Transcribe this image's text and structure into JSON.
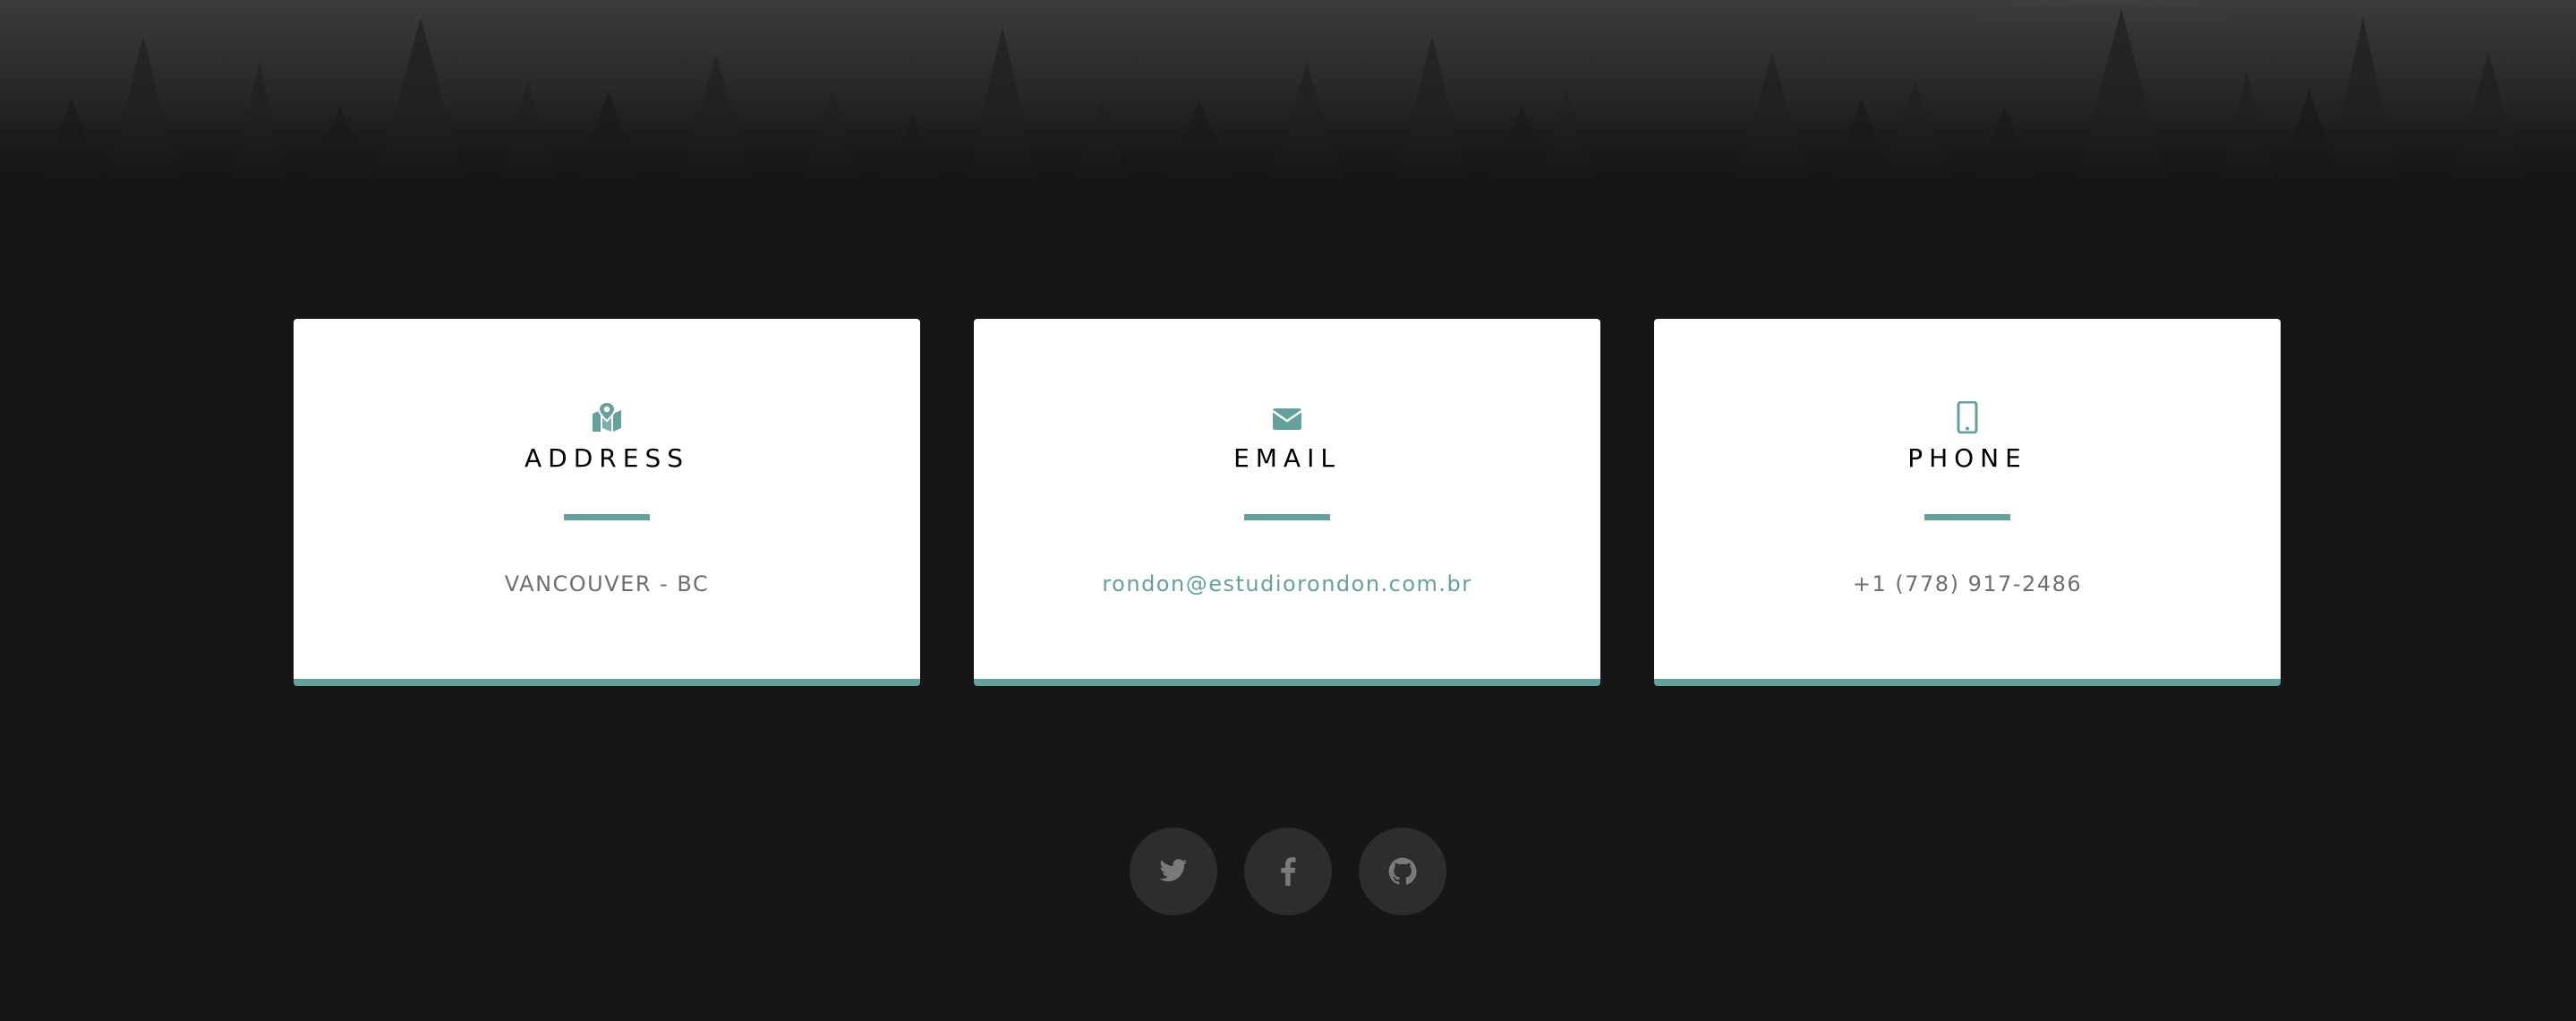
{
  "colors": {
    "background": "#161616",
    "accent": "#64a19d",
    "card": "#ffffff",
    "title": "#000000",
    "muted_text": "#6f6f6f",
    "social_bg": "rgba(255,255,255,0.1)",
    "social_icon": "#7a7a7a"
  },
  "cards": [
    {
      "icon": "map-marked-icon",
      "title": "ADDRESS",
      "value": "VANCOUVER - BC"
    },
    {
      "icon": "envelope-icon",
      "title": "EMAIL",
      "value": "rondon@estudiorondon.com.br"
    },
    {
      "icon": "mobile-phone-icon",
      "title": "PHONE",
      "value": "+1 (778) 917-2486"
    }
  ],
  "social": [
    {
      "icon": "twitter-icon"
    },
    {
      "icon": "facebook-icon"
    },
    {
      "icon": "github-icon"
    }
  ]
}
